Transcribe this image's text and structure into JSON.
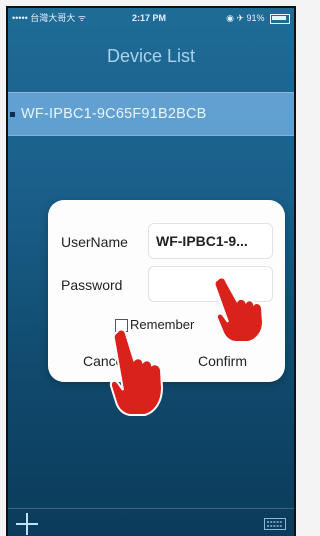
{
  "statusbar": {
    "carrier": "••••• 台灣大哥大 ᯤ",
    "time": "2:17 PM",
    "right": "◉ ✈ 91%"
  },
  "navbar": {
    "title": "Device List"
  },
  "device_list": {
    "items": [
      {
        "name": "WF-IPBC1-9C65F91B2BCB"
      }
    ]
  },
  "login_dialog": {
    "username_label": "UserName",
    "username_value": "WF-IPBC1-9...",
    "password_label": "Password",
    "password_value": "",
    "remember_label": "Remember",
    "remember_checked": false,
    "cancel_label": "Cancel",
    "confirm_label": "Confirm"
  },
  "colors": {
    "background_top": "#1e6c96",
    "background_bottom": "#0b3b5a",
    "device_row": "#78b4e6",
    "hand": "#d9221b"
  },
  "icons": [
    "wifi-icon",
    "battery-icon",
    "add-icon",
    "keyboard-icon",
    "pointing-hand-icon"
  ]
}
